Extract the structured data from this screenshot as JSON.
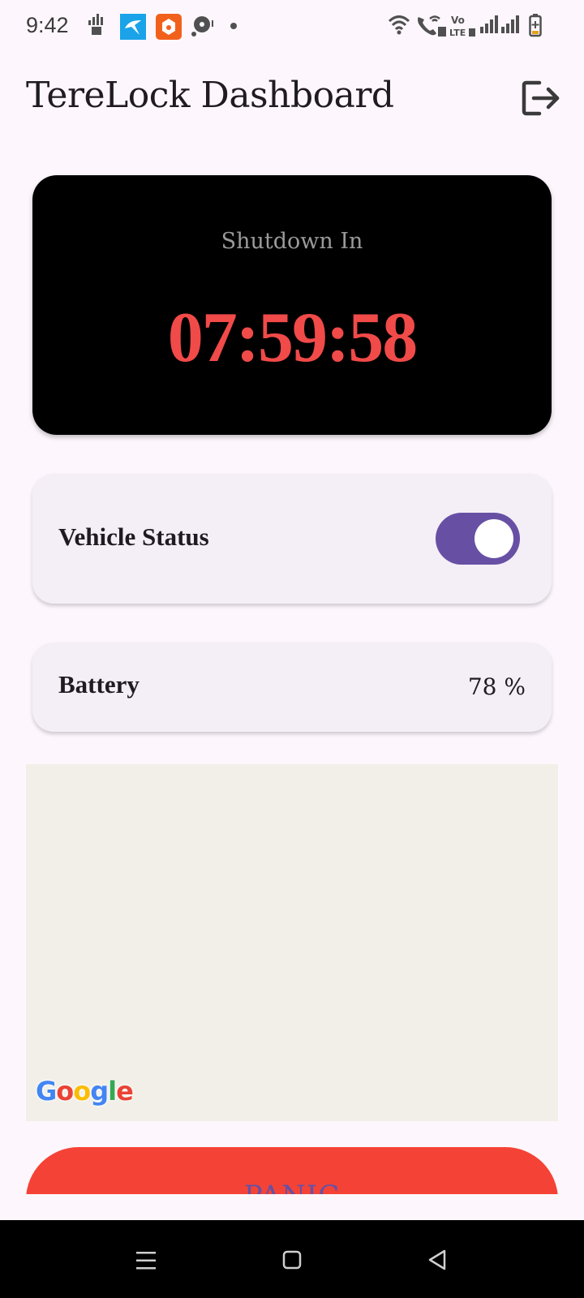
{
  "status_bar": {
    "time": "9:42",
    "icons": [
      "sim-signal-icon",
      "messenger-app-icon",
      "music-app-icon",
      "sync-icon",
      "dot-icon",
      "wifi-icon",
      "wifi-calling-icon",
      "volte-icon",
      "signal-bars-icon",
      "signal-bars-icon",
      "battery-charging-icon"
    ]
  },
  "header": {
    "title": "TereLock Dashboard",
    "logout_icon": "logout-icon"
  },
  "countdown": {
    "label": "Shutdown In",
    "value": "07:59:58"
  },
  "vehicle": {
    "label": "Vehicle Status",
    "toggle_on": true
  },
  "battery": {
    "label": "Battery",
    "value": "78 %"
  },
  "map": {
    "attribution": "Google"
  },
  "panic": {
    "label": "PANIC"
  },
  "colors": {
    "accent": "#6750a4",
    "countdown_text": "#f04a49",
    "panic": "#f44336",
    "background": "#fdf7fd"
  },
  "nav": {
    "icons": [
      "recent-apps-icon",
      "home-icon",
      "back-icon"
    ]
  }
}
